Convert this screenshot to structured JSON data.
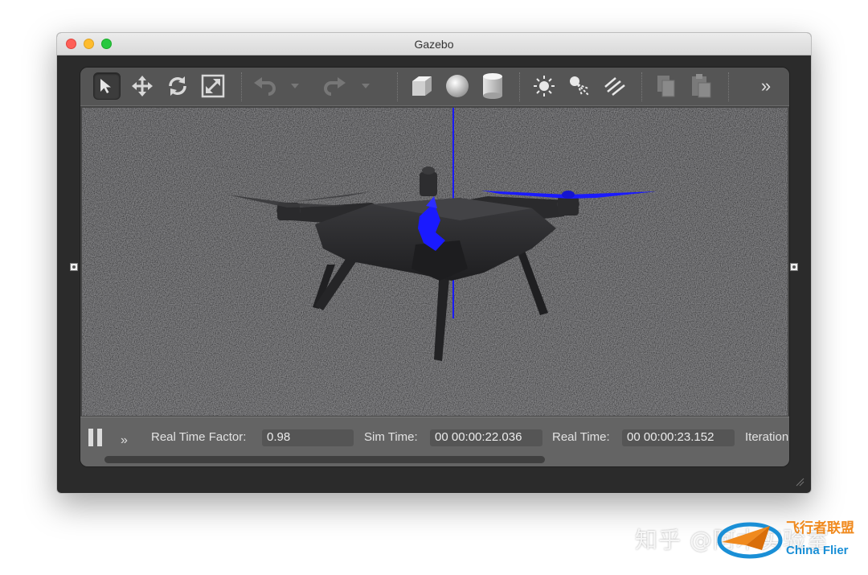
{
  "window": {
    "title": "Gazebo"
  },
  "toolbar": {
    "tools": [
      {
        "name": "select-mode",
        "icon": "arrow-pointer-icon",
        "active": true
      },
      {
        "name": "translate-mode",
        "icon": "move-arrows-icon"
      },
      {
        "name": "rotate-mode",
        "icon": "rotate-icon"
      },
      {
        "name": "scale-mode",
        "icon": "scale-icon"
      },
      {
        "name": "undo",
        "icon": "undo-icon"
      },
      {
        "name": "undo-history",
        "icon": "chevron-down-icon"
      },
      {
        "name": "redo",
        "icon": "redo-icon"
      },
      {
        "name": "redo-history",
        "icon": "chevron-down-icon"
      },
      {
        "name": "box",
        "icon": "box-icon"
      },
      {
        "name": "sphere",
        "icon": "sphere-icon"
      },
      {
        "name": "cylinder",
        "icon": "cylinder-icon"
      },
      {
        "name": "point-light",
        "icon": "point-light-icon"
      },
      {
        "name": "spot-light",
        "icon": "spot-light-icon"
      },
      {
        "name": "directional-light",
        "icon": "directional-light-icon"
      },
      {
        "name": "copy",
        "icon": "copy-icon"
      },
      {
        "name": "paste",
        "icon": "paste-icon"
      },
      {
        "name": "more",
        "icon": "double-chevron-right-icon"
      }
    ],
    "more_label": "»"
  },
  "status": {
    "real_time_factor_label": "Real Time Factor:",
    "real_time_factor_value": "0.98",
    "sim_time_label": "Sim Time:",
    "sim_time_value": "00 00:00:22.036",
    "real_time_label": "Real Time:",
    "real_time_value": "00 00:00:23.152",
    "iterations_label": "Iteration",
    "step_label": "»",
    "scroll_fraction": 0.62
  },
  "watermark": {
    "zhihu": "知乎 @阿木实验室",
    "logo_cn": "飞行者联盟",
    "logo_en": "China Flier"
  },
  "colors": {
    "axis_blue": "#1a1aff",
    "toolbar_bg": "#555555",
    "status_bg": "#646464"
  }
}
